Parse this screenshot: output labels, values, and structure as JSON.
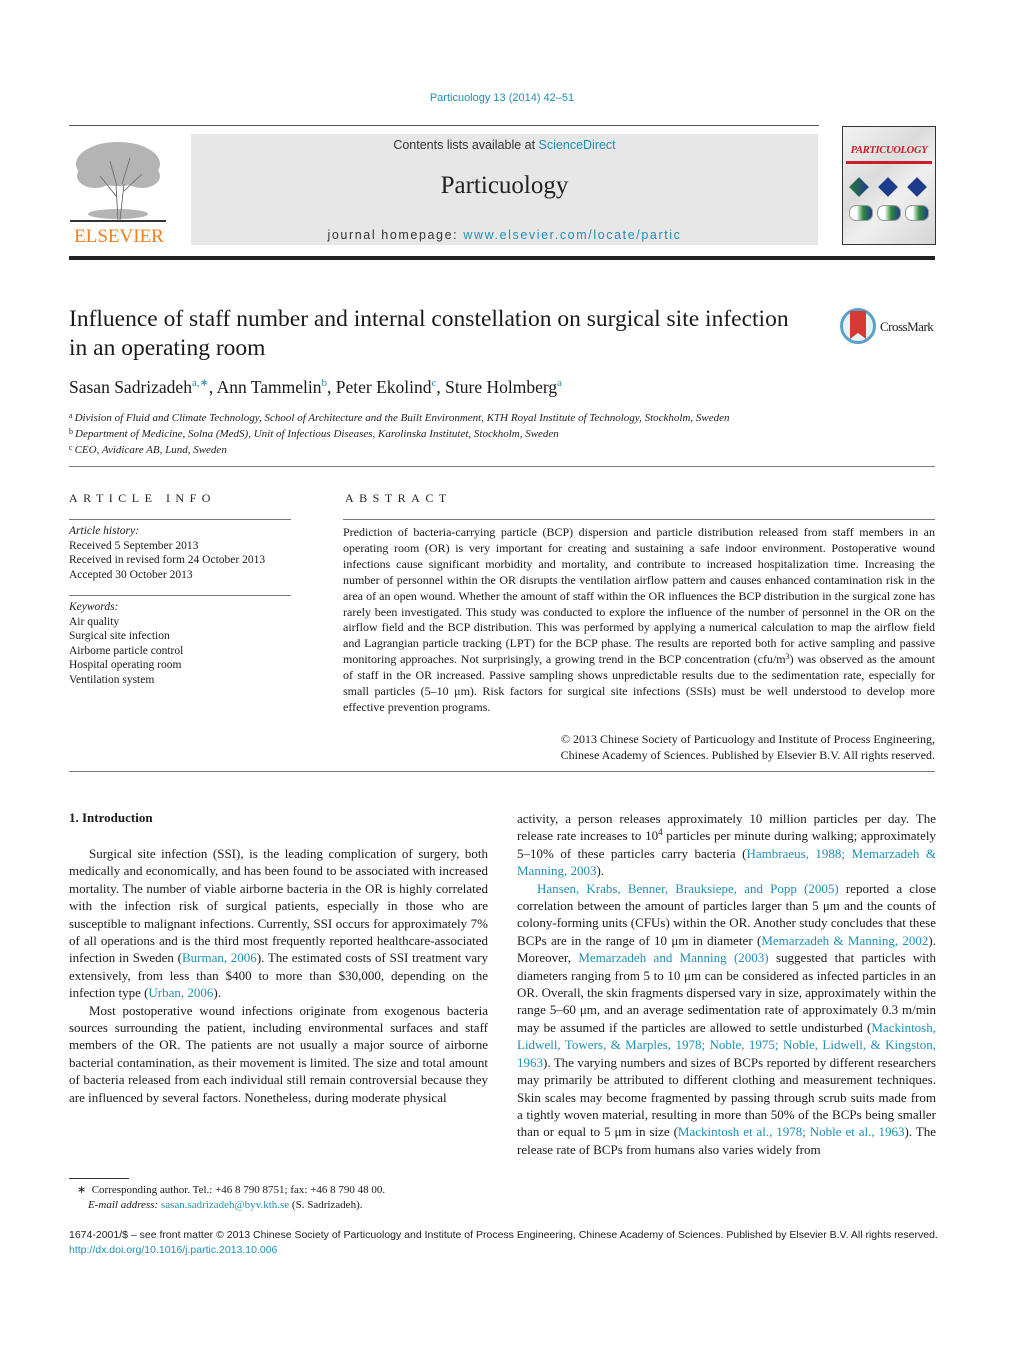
{
  "header": {
    "citation": "Particuology 13 (2014) 42–51",
    "publisher_logo_text": "ELSEVIER",
    "contents_prefix": "Contents lists available at ",
    "contents_link": "ScienceDirect",
    "journal_name": "Particuology",
    "homepage_prefix": "journal homepage: ",
    "homepage_link": "www.elsevier.com/locate/partic",
    "cover_title": "PARTICUOLOGY",
    "crossmark_label": "CrossMark"
  },
  "article": {
    "title": "Influence of staff number and internal constellation on surgical site infection in an operating room",
    "authors": [
      {
        "name": "Sasan Sadrizadeh",
        "sup": "a,∗"
      },
      {
        "name": "Ann Tammelin",
        "sup": "b"
      },
      {
        "name": "Peter Ekolind",
        "sup": "c"
      },
      {
        "name": "Sture Holmberg",
        "sup": "a"
      }
    ],
    "affiliations": [
      {
        "key": "a",
        "text": "Division of Fluid and Climate Technology, School of Architecture and the Built Environment, KTH Royal Institute of Technology, Stockholm, Sweden"
      },
      {
        "key": "b",
        "text": "Department of Medicine, Solna (MedS), Unit of Infectious Diseases, Karolinska Institutet, Stockholm, Sweden"
      },
      {
        "key": "c",
        "text": "CEO, Avidicare AB, Lund, Sweden"
      }
    ]
  },
  "article_info": {
    "label": "ARTICLE INFO",
    "history_label": "Article history:",
    "history": [
      "Received 5 September 2013",
      "Received in revised form 24 October 2013",
      "Accepted 30 October 2013"
    ],
    "keywords_label": "Keywords:",
    "keywords": [
      "Air quality",
      "Surgical site infection",
      "Airborne particle control",
      "Hospital operating room",
      "Ventilation system"
    ]
  },
  "abstract": {
    "label": "ABSTRACT",
    "text_part1": "Prediction of bacteria-carrying particle (BCP) dispersion and particle distribution released from staff members in an operating room (OR) is very important for creating and sustaining a safe indoor environment. Postoperative wound infections cause significant morbidity and mortality, and contribute to increased hospitalization time. Increasing the number of personnel within the OR disrupts the ventilation airflow pattern and causes enhanced contamination risk in the area of an open wound. Whether the amount of staff within the OR influences the BCP distribution in the surgical zone has rarely been investigated. This study was conducted to explore the influence of the number of personnel in the OR on the airflow field and the BCP distribution. This was performed by applying a numerical calculation to map the airflow field and Lagrangian particle tracking (LPT) for the BCP phase. The results are reported both for active sampling and passive monitoring approaches. Not surprisingly, a growing trend in the BCP concentration (cfu/m",
    "text_sup": "3",
    "text_part2": ") was observed as the amount of staff in the OR increased. Passive sampling shows unpredictable results due to the sedimentation rate, especially for small particles (5–10 μm). Risk factors for surgical site infections (SSIs) must be well understood to develop more effective prevention programs.",
    "copyright": "© 2013 Chinese Society of Particuology and Institute of Process Engineering, Chinese Academy of Sciences. Published by Elsevier B.V. All rights reserved."
  },
  "body": {
    "section_heading": "1.  Introduction",
    "p1_a": "Surgical site infection (SSI), is the leading complication of surgery, both medically and economically, and has been found to be associated with increased mortality. The number of viable airborne bacteria in the OR is highly correlated with the infection risk of surgical patients, especially in those who are susceptible to malignant infections. Currently, SSI occurs for approximately 7% of all operations and is the third most frequently reported healthcare-associated infection in Sweden (",
    "p1_ref1": "Burman, 2006",
    "p1_b": "). The estimated costs of SSI treatment vary extensively, from less than $400 to more than $30,000, depending on the infection type (",
    "p1_ref2": "Urban, 2006",
    "p1_c": ").",
    "p2_a": "Most postoperative wound infections originate from exogenous bacteria sources surrounding the patient, including environmental surfaces and staff members of the OR. The patients are not usually a major source of airborne bacterial contamination, as their movement is limited. The size and total amount of bacteria released from each individual still remain controversial because they are influenced by several factors. Nonetheless, during moderate physical",
    "r1_a": "activity, a person releases approximately 10 million particles per day. The release rate increases to 10",
    "r1_sup": "4",
    "r1_b": " particles per minute during walking; approximately 5–10% of these particles carry bacteria (",
    "r1_ref": "Hambraeus, 1988; Memarzadeh & Manning, 2003",
    "r1_c": ").",
    "r2_ref1": "Hansen, Krabs, Benner, Brauksiepe, and Popp (2005)",
    "r2_a": " reported a close correlation between the amount of particles larger than 5 μm and the counts of colony-forming units (CFUs) within the OR. Another study concludes that these BCPs are in the range of 10 μm in diameter (",
    "r2_ref2": "Memarzadeh & Manning, 2002",
    "r2_b": "). Moreover, ",
    "r2_ref3": "Memarzadeh and Manning (2003)",
    "r2_c": " suggested that particles with diameters ranging from 5 to 10 μm can be considered as infected particles in an OR. Overall, the skin fragments dispersed vary in size, approximately within the range 5–60 μm, and an average sedimentation rate of approximately 0.3 m/min may be assumed if the particles are allowed to settle undisturbed (",
    "r2_ref4": "Mackintosh, Lidwell, Towers, & Marples, 1978; Noble, 1975; Noble, Lidwell, & Kingston, 1963",
    "r2_d": "). The varying numbers and sizes of BCPs reported by different researchers may primarily be attributed to different clothing and measurement techniques. Skin scales may become fragmented by passing through scrub suits made from a tightly woven material, resulting in more than 50% of the BCPs being smaller than or equal to 5 μm in size (",
    "r2_ref5": "Mackintosh et al., 1978; Noble et al., 1963",
    "r2_e": "). The release rate of BCPs from humans also varies widely from"
  },
  "footnote": {
    "marker": "∗",
    "corresponding": "Corresponding author. Tel.: +46 8 790 8751; fax: +46 8 790 48 00.",
    "email_label": "E-mail address:",
    "email": "sasan.sadrizadeh@byv.kth.se",
    "email_suffix": " (S. Sadrizadeh)."
  },
  "bottom": {
    "issn_line": "1674-2001/$ – see front matter © 2013 Chinese Society of Particuology and Institute of Process Engineering, Chinese Academy of Sciences. Published by Elsevier B.V. All rights reserved.",
    "doi": "http://dx.doi.org/10.1016/j.partic.2013.10.006"
  },
  "colors": {
    "link": "#1f8fb3",
    "elsevier_orange": "#f07f1b",
    "masthead_bg": "#e7e7e7",
    "crossmark_red": "#d63b2f"
  }
}
